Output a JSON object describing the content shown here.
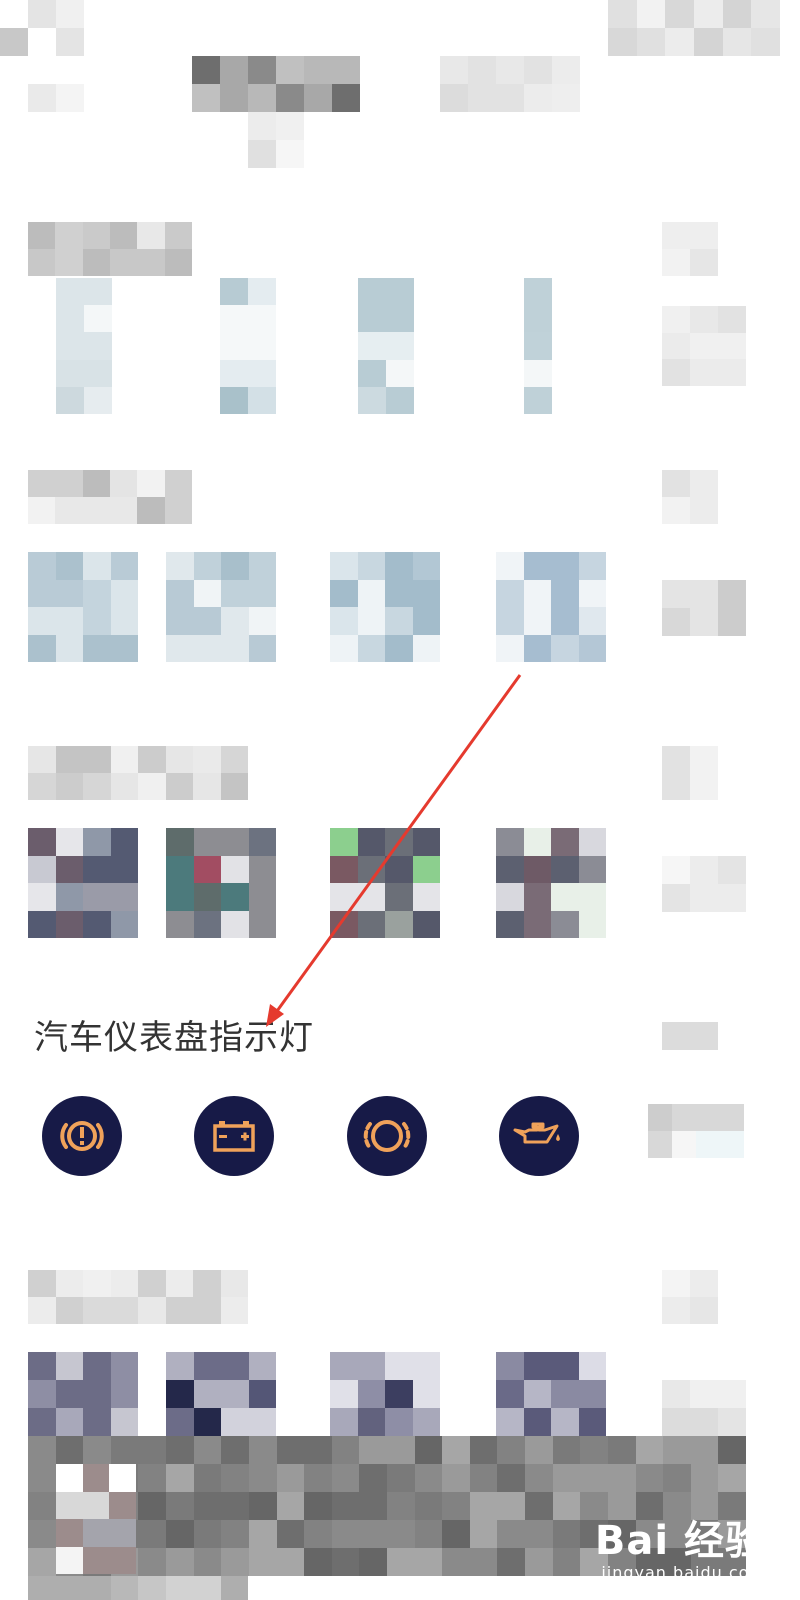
{
  "section": {
    "title": "汽车仪表盘指示灯"
  },
  "indicator_icons": [
    {
      "name": "parking-brake-warning-icon"
    },
    {
      "name": "battery-warning-icon"
    },
    {
      "name": "brake-pad-wear-icon"
    },
    {
      "name": "oil-pressure-warning-icon"
    }
  ],
  "watermark": {
    "brand": "Bai 经验",
    "domain": "jingyan.baidu.com"
  },
  "colors": {
    "icon_background": "#171a47",
    "icon_foreground": "#f0a25a",
    "annotation_arrow": "#e53a2e"
  }
}
